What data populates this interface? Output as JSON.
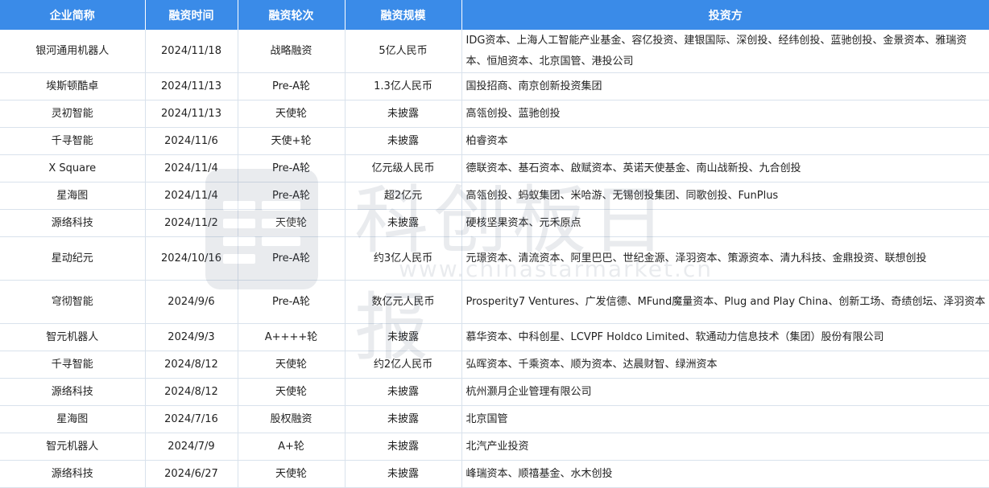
{
  "headers": [
    "企业简称",
    "融资时间",
    "融资轮次",
    "融资规模",
    "投资方"
  ],
  "rows": [
    [
      "银河通用机器人",
      "2024/11/18",
      "战略融资",
      "5亿人民币",
      "IDG资本、上海人工智能产业基金、容亿投资、建银国际、深创投、经纬创投、蓝驰创投、金景资本、雅瑞资本、恒旭资本、北京国管、港投公司"
    ],
    [
      "埃斯顿酷卓",
      "2024/11/13",
      "Pre-A轮",
      "1.3亿人民币",
      "国投招商、南京创新投资集团"
    ],
    [
      "灵初智能",
      "2024/11/13",
      "天使轮",
      "未披露",
      "高瓴创投、蓝驰创投"
    ],
    [
      "千寻智能",
      "2024/11/6",
      "天使+轮",
      "未披露",
      "柏睿资本"
    ],
    [
      "X Square",
      "2024/11/4",
      "Pre-A轮",
      "亿元级人民币",
      "德联资本、基石资本、啟赋资本、英诺天使基金、南山战新投、九合创投"
    ],
    [
      "星海图",
      "2024/11/4",
      "Pre-A轮",
      "超2亿元",
      "高瓴创投、蚂蚁集团、米哈游、无锡创投集团、同歌创投、FunPlus"
    ],
    [
      "源络科技",
      "2024/11/2",
      "天使轮",
      "未披露",
      "硬核坚果资本、元禾原点"
    ],
    [
      "星动纪元",
      "2024/10/16",
      "Pre-A轮",
      "约3亿人民币",
      "元璟资本、清流资本、阿里巴巴、世纪金源、泽羽资本、策源资本、清九科技、金鼎投资、联想创投"
    ],
    [
      "穹彻智能",
      "2024/9/6",
      "Pre-A轮",
      "数亿元人民币",
      "Prosperity7 Ventures、广发信德、MFund魔量资本、Plug and Play China、创新工场、奇绩创坛、泽羽资本"
    ],
    [
      "智元机器人",
      "2024/9/3",
      "A++++轮",
      "未披露",
      "慕华资本、中科创星、LCVPF Holdco Limited、软通动力信息技术（集团）股份有限公司"
    ],
    [
      "千寻智能",
      "2024/8/12",
      "天使轮",
      "约2亿人民币",
      "弘晖资本、千乘资本、顺为资本、达晨财智、绿洲资本"
    ],
    [
      "源络科技",
      "2024/8/12",
      "天使轮",
      "未披露",
      "杭州灏月企业管理有限公司"
    ],
    [
      "星海图",
      "2024/7/16",
      "股权融资",
      "未披露",
      "北京国管"
    ],
    [
      "智元机器人",
      "2024/7/9",
      "A+轮",
      "未披露",
      "北汽产业投资"
    ],
    [
      "源络科技",
      "2024/6/27",
      "天使轮",
      "未披露",
      "峰瑞资本、顺禧基金、水木创投"
    ]
  ],
  "watermark": {
    "text": "科创板日报",
    "url": "www.chinastarmarket.cn"
  },
  "colors": {
    "header_bg": "#3a8be8",
    "header_text": "#ffffff",
    "grid": "#d9e2ec"
  }
}
